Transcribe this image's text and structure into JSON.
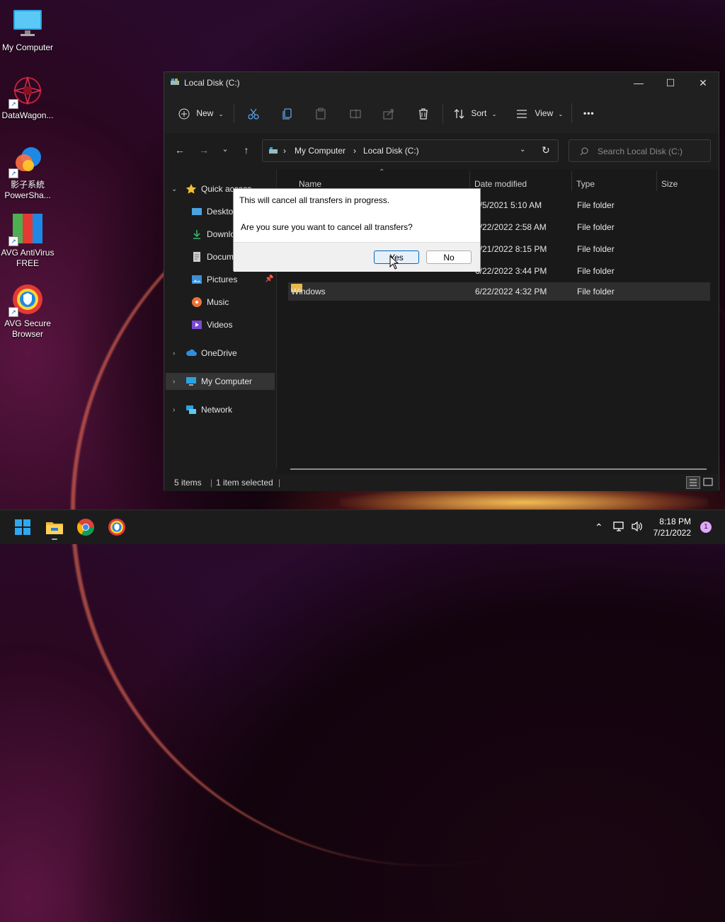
{
  "desktop": {
    "icons": [
      {
        "label": "My Computer"
      },
      {
        "label": "DataWagon..."
      },
      {
        "label": "影子系統\nPowerSha..."
      },
      {
        "label": "AVG AntiVirus\nFREE"
      },
      {
        "label": "AVG Secure\nBrowser"
      }
    ]
  },
  "window": {
    "title": "Local Disk (C:)",
    "controls": {
      "minimize": "—",
      "maximize": "☐",
      "close": "✕"
    },
    "toolbar": {
      "new_label": "New",
      "sort_label": "Sort",
      "view_label": "View",
      "more_label": "•••"
    },
    "address": {
      "segments": [
        "My Computer",
        "Local Disk (C:)"
      ],
      "separator": "›"
    },
    "search": {
      "placeholder": "Search Local Disk (C:)"
    },
    "nav": {
      "quick_access": "Quick access",
      "items": [
        {
          "label": "Desktop"
        },
        {
          "label": "Downloads"
        },
        {
          "label": "Documents"
        },
        {
          "label": "Pictures"
        },
        {
          "label": "Music"
        },
        {
          "label": "Videos"
        }
      ],
      "onedrive": "OneDrive",
      "my_computer": "My Computer",
      "network": "Network"
    },
    "columns": {
      "name": "Name",
      "date": "Date modified",
      "type": "Type",
      "size": "Size"
    },
    "rows": [
      {
        "name": "",
        "date": "6/5/2021 5:10 AM",
        "type": "File folder"
      },
      {
        "name": "",
        "date": "6/22/2022 2:58 AM",
        "type": "File folder"
      },
      {
        "name": "",
        "date": "7/21/2022 8:15 PM",
        "type": "File folder"
      },
      {
        "name": "",
        "date": "6/22/2022 3:44 PM",
        "type": "File folder"
      },
      {
        "name": "Windows",
        "date": "6/22/2022 4:32 PM",
        "type": "File folder"
      }
    ],
    "status": {
      "items": "5 items",
      "selected": "1 item selected"
    }
  },
  "dialog": {
    "line1": "This will cancel all transfers in progress.",
    "line2": "Are you sure you want to cancel all transfers?",
    "yes_label": "Yes",
    "no_label": "No"
  },
  "taskbar": {
    "time": "8:18 PM",
    "date": "7/21/2022",
    "notifications": "1"
  },
  "colors": {
    "accent": "#0067c0",
    "folder": "#e8b84a",
    "window_bg": "#1c1c1c"
  }
}
